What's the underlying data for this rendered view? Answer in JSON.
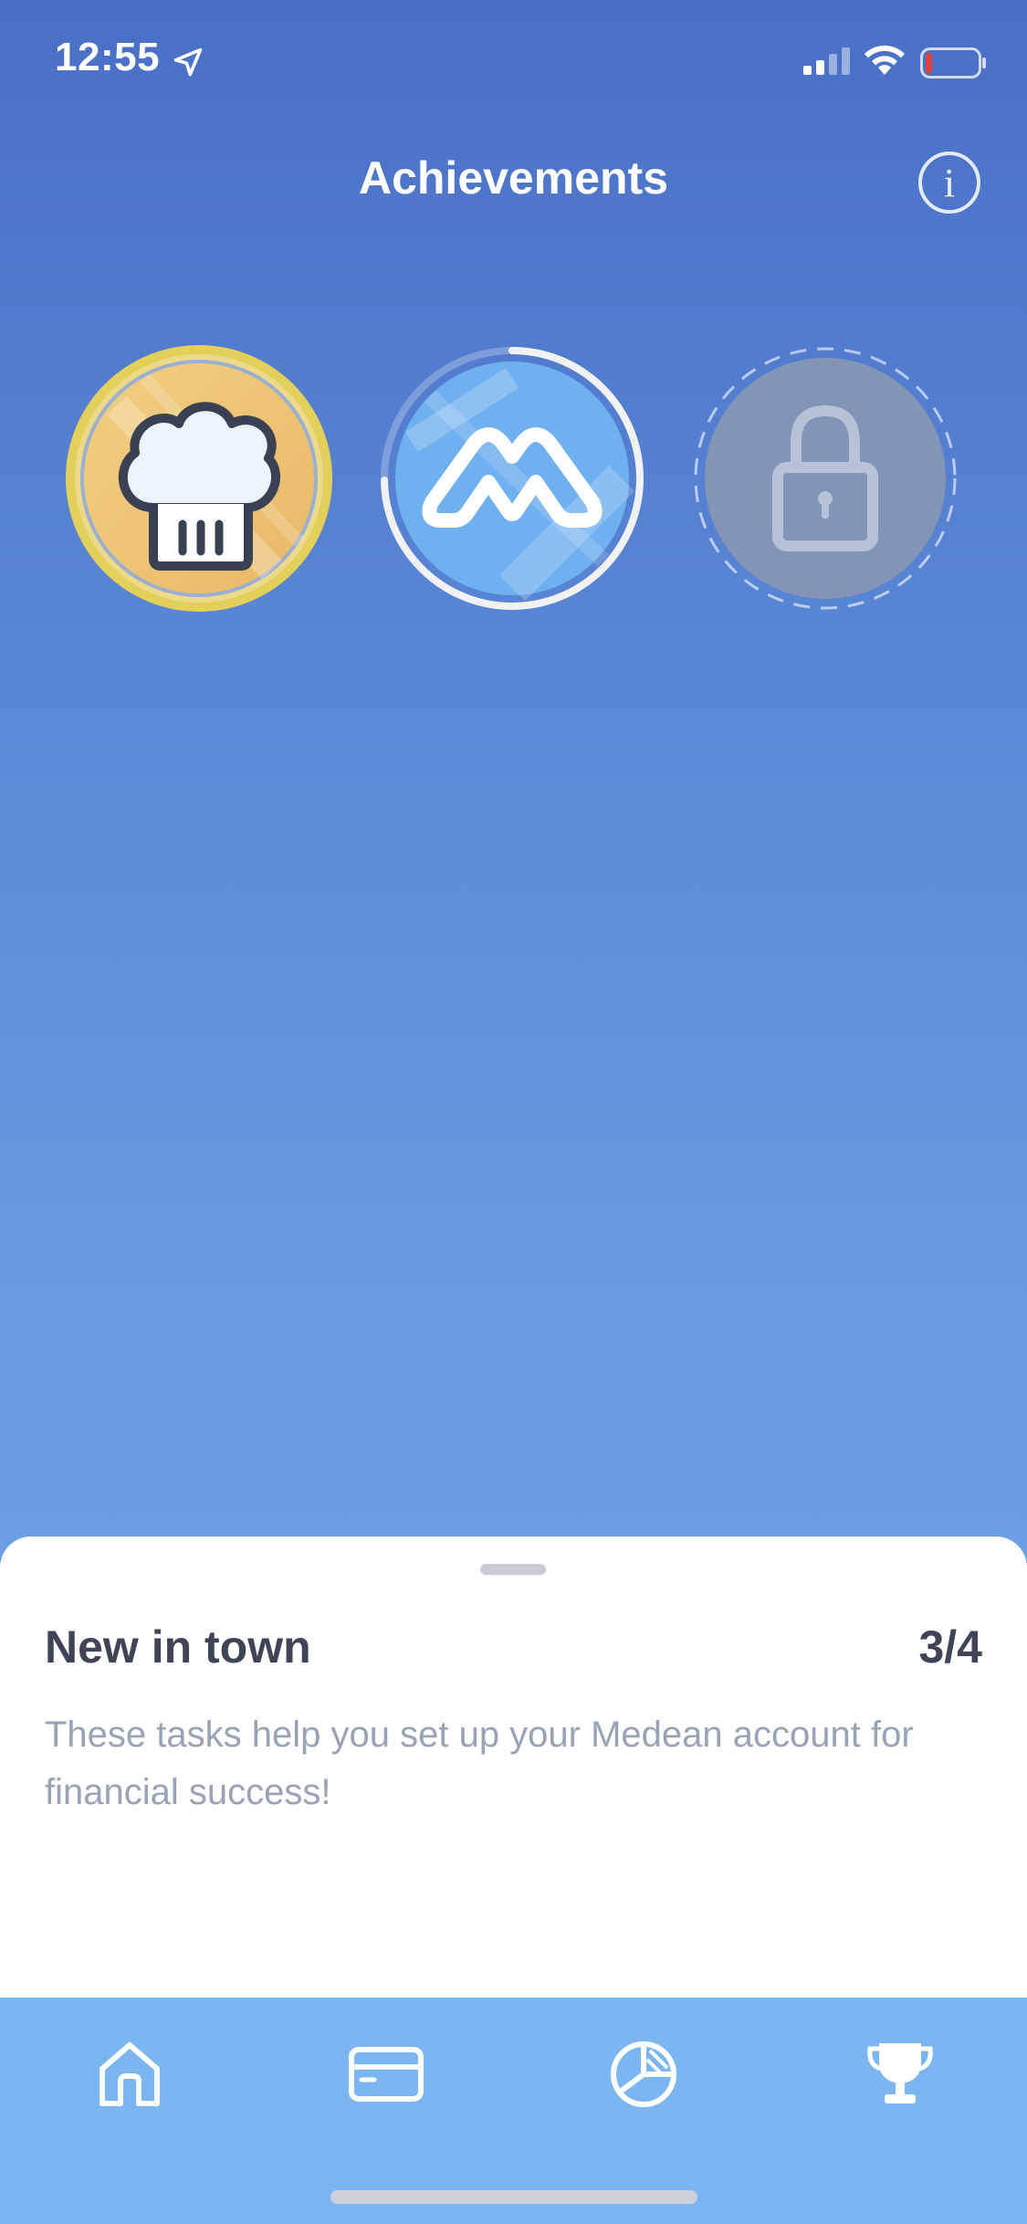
{
  "status_bar": {
    "time": "12:55"
  },
  "header": {
    "title": "Achievements",
    "info_label": "i"
  },
  "badges": [
    {
      "name": "chef-hat",
      "state": "earned"
    },
    {
      "name": "medean-logo",
      "state": "in-progress"
    },
    {
      "name": "lock",
      "state": "locked"
    }
  ],
  "sheet": {
    "title": "New in town",
    "progress": "3/4",
    "description": "These tasks help you set up your Medean account for financial success!"
  },
  "tab_bar": {
    "items": [
      {
        "icon": "home-icon"
      },
      {
        "icon": "card-icon"
      },
      {
        "icon": "pie-chart-icon"
      },
      {
        "icon": "trophy-icon",
        "active": true
      }
    ]
  },
  "colors": {
    "background_top": "#4a6fc6",
    "background_bottom": "#6fa5e6",
    "tab_bar": "#7cb6f0",
    "sheet_text": "#3f4556",
    "sheet_subtext": "#9aa3b5",
    "gold": "#e8c45a"
  }
}
